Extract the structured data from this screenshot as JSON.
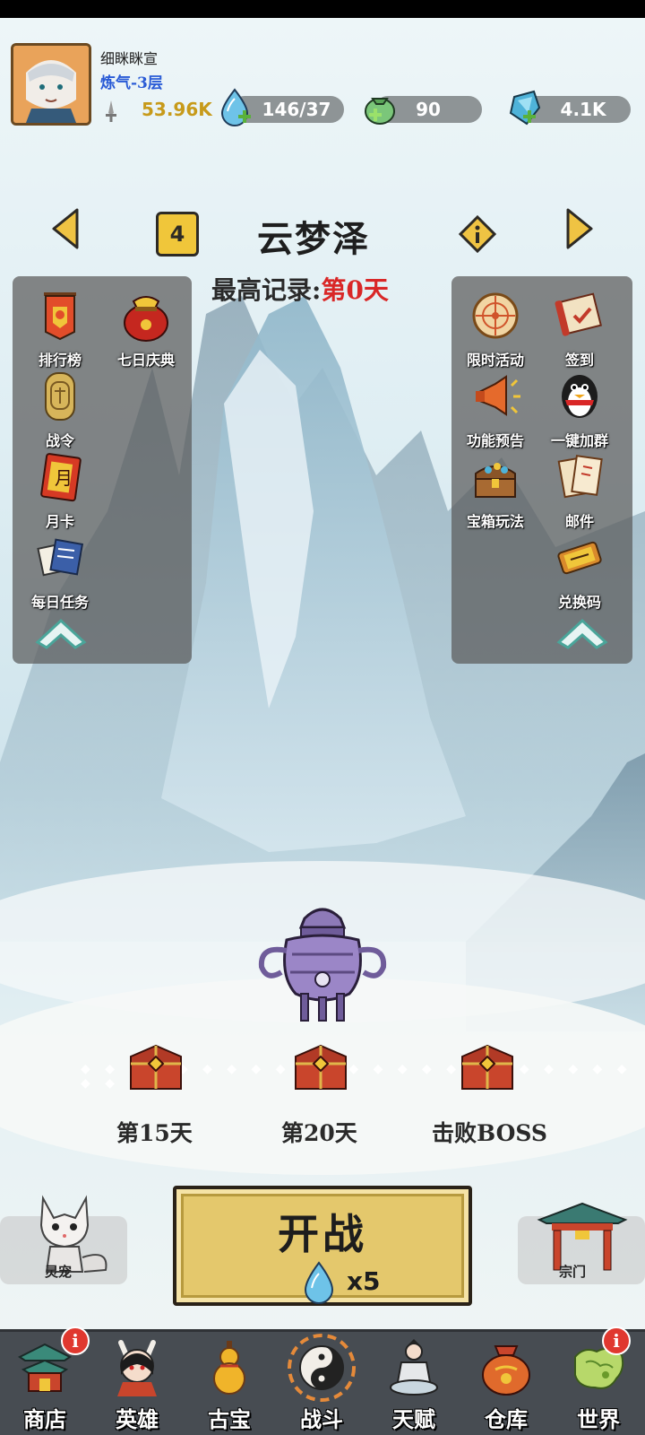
{
  "player": {
    "name": "细眯眯宣",
    "level": "炼气-3层",
    "power": "53.96K"
  },
  "resources": {
    "stamina": "146/37",
    "jade": "90",
    "crystal": "4.1K"
  },
  "stage": {
    "number": "4",
    "name": "云梦泽",
    "record_label": "最高记录:",
    "record_value": "第0天"
  },
  "left_panel": [
    {
      "label": "排行榜",
      "icon": "ranking-banner-icon"
    },
    {
      "label": "七日庆典",
      "icon": "lucky-bag-icon"
    },
    {
      "label": "战令",
      "icon": "battle-pass-token-icon"
    },
    {
      "label": "月卡",
      "icon": "monthly-card-icon"
    },
    {
      "label": "每日任务",
      "icon": "daily-task-book-icon"
    }
  ],
  "right_panel": [
    {
      "label": "限时活动",
      "icon": "compass-event-icon"
    },
    {
      "label": "签到",
      "icon": "scroll-checkin-icon"
    },
    {
      "label": "功能预告",
      "icon": "horn-preview-icon"
    },
    {
      "label": "一键加群",
      "icon": "penguin-group-icon"
    },
    {
      "label": "宝箱玩法",
      "icon": "treasure-chest-icon"
    },
    {
      "label": "邮件",
      "icon": "mail-letters-icon"
    },
    {
      "label": "兑换码",
      "icon": "ticket-code-icon"
    }
  ],
  "milestones": [
    {
      "label": "第15天"
    },
    {
      "label": "第20天"
    },
    {
      "label": "击败BOSS"
    }
  ],
  "side_buttons": {
    "pet": "灵宠",
    "sect": "宗门"
  },
  "start_button": {
    "title": "开战",
    "cost": "x5"
  },
  "bottom_nav": [
    {
      "label": "商店",
      "icon": "shop-pavilion-icon",
      "badge": "i"
    },
    {
      "label": "英雄",
      "icon": "hero-portrait-icon"
    },
    {
      "label": "古宝",
      "icon": "golden-gourd-icon"
    },
    {
      "label": "战斗",
      "icon": "yin-yang-icon"
    },
    {
      "label": "天赋",
      "icon": "meditating-monk-icon"
    },
    {
      "label": "仓库",
      "icon": "storage-sack-icon"
    },
    {
      "label": "世界",
      "icon": "world-map-icon",
      "badge": "i"
    }
  ],
  "colors": {
    "accent_gold": "#f0c63a",
    "record_red": "#d92727",
    "level_blue": "#2a5bd6",
    "panel_gray": "#5a5a5a"
  }
}
